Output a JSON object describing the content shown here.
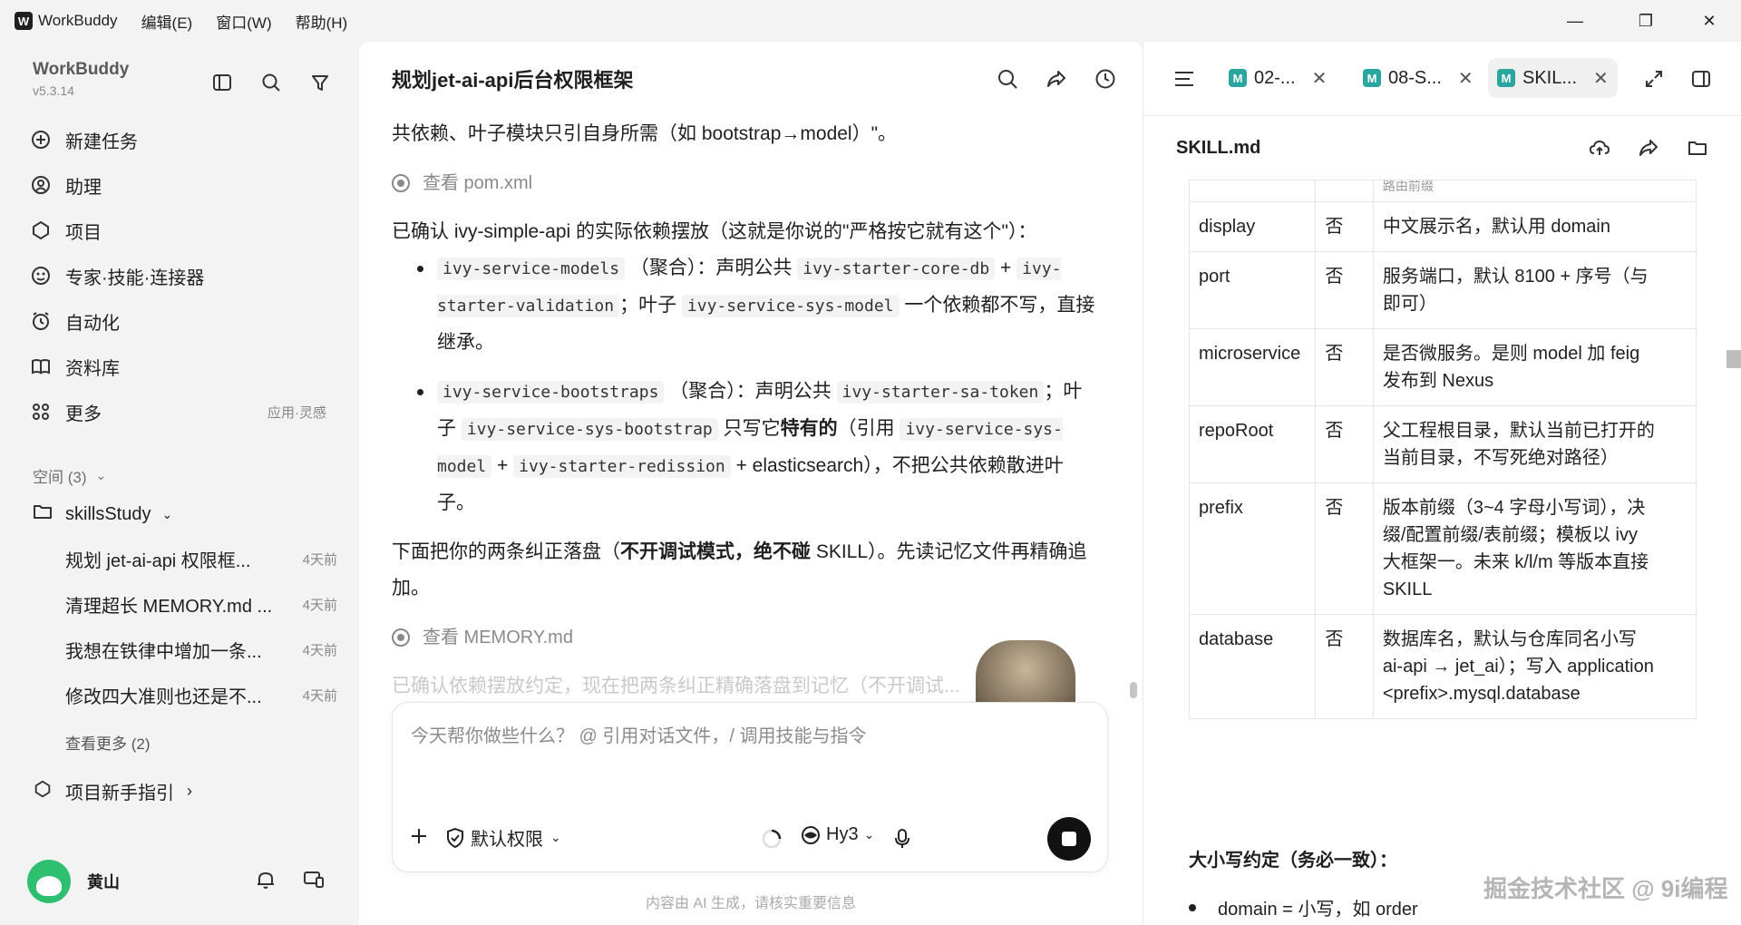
{
  "titlebar": {
    "app_name": "WorkBuddy",
    "menus": [
      "编辑(E)",
      "窗口(W)",
      "帮助(H)"
    ],
    "minimize": "—",
    "restore": "❐",
    "close": "✕"
  },
  "sidebar": {
    "brand_name": "WorkBuddy",
    "version": "v5.3.14",
    "nav": [
      {
        "label": "新建任务",
        "icon": "plus-circle-icon"
      },
      {
        "label": "助理",
        "icon": "assistant-icon"
      },
      {
        "label": "项目",
        "icon": "project-icon"
      },
      {
        "label": "专家·技能·连接器",
        "icon": "expert-icon"
      },
      {
        "label": "自动化",
        "icon": "alarm-icon"
      },
      {
        "label": "资料库",
        "icon": "book-icon"
      },
      {
        "label": "更多",
        "icon": "grid-icon",
        "extra": "应用·灵感"
      }
    ],
    "spaces_label": "空间 (3)",
    "space_name": "skillsStudy",
    "tasks": [
      {
        "title": "规划 jet-ai-api 权限框...",
        "time": "4天前"
      },
      {
        "title": "清理超长 MEMORY.md ...",
        "time": "4天前"
      },
      {
        "title": "我想在铁律中增加一条...",
        "time": "4天前"
      },
      {
        "title": "修改四大准则也还是不...",
        "time": "4天前"
      }
    ],
    "see_more": "查看更多 (2)",
    "guide": "项目新手指引",
    "user_name": "黄山"
  },
  "chat": {
    "title": "规划jet-ai-api后台权限框架",
    "line_cut": "共依赖、叶子模块只引自身所需（如 bootstrap→model）\"。",
    "view_pom": "查看 pom.xml",
    "confirm_line": "已确认 ivy-simple-api 的实际依赖摆放（这就是你说的\"严格按它就有这个\"）：",
    "b1": {
      "code1": "ivy-service-models",
      "t1": "（聚合）：声明公共",
      "code2": "ivy-starter-core-db",
      "plus": "+",
      "code3": "ivy-starter-validation",
      "t2": "；叶子",
      "code4": "ivy-service-sys-model",
      "t3": "一个依赖都不写，直接继承。"
    },
    "b2": {
      "code1": "ivy-service-bootstraps",
      "t1": "（聚合）：声明公共",
      "code2": "ivy-starter-sa-token",
      "t2": "；叶子",
      "code3": "ivy-service-sys-bootstrap",
      "t3": "只写它",
      "bold1": "特有的",
      "t4": "（引用",
      "code4": "ivy-service-sys-model",
      "plus1": "+",
      "code5": "ivy-starter-redission",
      "t5": "+ elasticsearch），不把公共依赖散进叶子。"
    },
    "p2_a": "下面把你的两条纠正落盘（",
    "p2_bold": "不开调试模式，绝不碰",
    "p2_b": " SKILL）。先读记忆文件再精确追加。",
    "view_memory": "查看 MEMORY.md",
    "faded": "已确认依赖摆放约定，现在把两条纠正精确落盘到记忆（不开调试...",
    "composer_placeholder": "今天帮你做些什么？ @ 引用对话文件，/ 调用技能与指令",
    "permission": "默认权限",
    "model": "Hy3",
    "disclaimer": "内容由 AI 生成，请核实重要信息"
  },
  "rpanel": {
    "tabs": [
      {
        "label": "02-...",
        "active": false
      },
      {
        "label": "08-S...",
        "active": false
      },
      {
        "label": "SKIL...",
        "active": true
      }
    ],
    "file_name": "SKILL.md",
    "cut_row": "路由前缀",
    "rows": [
      {
        "name": "display",
        "req": "否",
        "desc": [
          "中文展示名，默认用 domain"
        ]
      },
      {
        "name": "port",
        "req": "否",
        "desc": [
          "服务端口，默认 8100 + 序号（与",
          "即可）"
        ]
      },
      {
        "name": "microservice",
        "req": "否",
        "desc": [
          "是否微服务。是则 model 加 feig",
          "发布到 Nexus"
        ]
      },
      {
        "name": "repoRoot",
        "req": "否",
        "desc": [
          "父工程根目录，默认当前已打开的",
          "当前目录，不写死绝对路径）"
        ]
      },
      {
        "name": "prefix",
        "req": "否",
        "desc": [
          "版本前缀（3~4 字母小写词），决",
          "缀/配置前缀/表前缀；模板以 ivy",
          "大框架一。未来 k/l/m 等版本直接",
          "SKILL"
        ]
      },
      {
        "name": "database",
        "req": "否",
        "desc": [
          "数据库名，默认与仓库同名小写",
          "ai-api → jet_ai）；写入 application",
          "<prefix>.mysql.database"
        ]
      }
    ],
    "rule_title": "大小写约定（务必一致）：",
    "rule_item": "domain = 小写，如 order",
    "watermark": "掘金技术社区 @ 9i编程"
  },
  "colors": {
    "bg": "#f3f3f4",
    "panel": "#ffffff",
    "accent_md": "#2aa6a0",
    "stop_button": "#111111"
  }
}
